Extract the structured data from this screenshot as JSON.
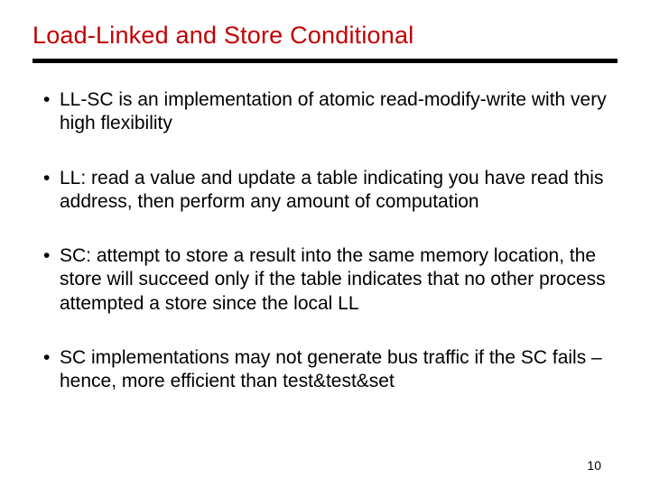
{
  "title": "Load-Linked and Store Conditional",
  "bullets": [
    "LL-SC is an implementation of atomic read-modify-write with very high flexibility",
    "LL: read a value and update a table indicating you have read this address, then perform any amount of computation",
    "SC: attempt to store a result into the same memory location, the store will succeed only if the table indicates that no other process attempted a store since the local LL",
    "SC implementations may not generate bus traffic if the SC fails – hence, more efficient than test&test&set"
  ],
  "page_number": "10"
}
